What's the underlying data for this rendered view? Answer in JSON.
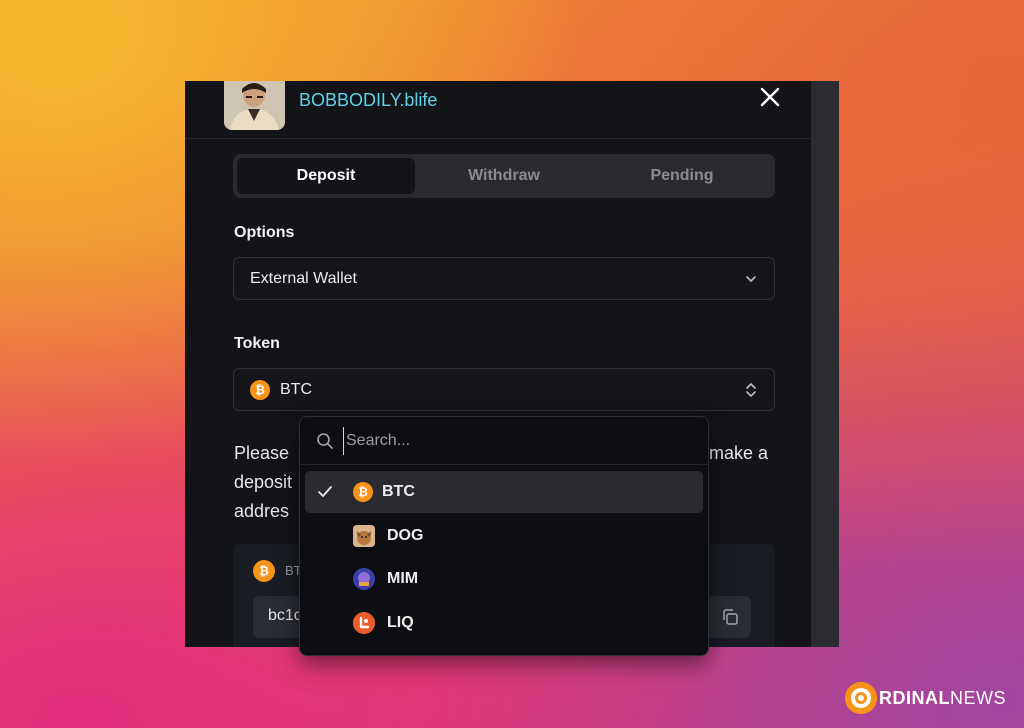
{
  "header": {
    "username": "BOBBODILY.blife"
  },
  "tabs": [
    {
      "label": "Deposit"
    },
    {
      "label": "Withdraw"
    },
    {
      "label": "Pending"
    }
  ],
  "options": {
    "label": "Options",
    "value": "External Wallet"
  },
  "token": {
    "label": "Token",
    "value": "BTC"
  },
  "instructions": {
    "line1_start": "Please",
    "line1_end": "make a",
    "line2_start": "deposit",
    "line3_start": "addres"
  },
  "address_card": {
    "label_fragment": "BT",
    "address_fragment": "bc1c"
  },
  "dropdown": {
    "search_placeholder": "Search...",
    "items": [
      {
        "label": "BTC",
        "selected": true
      },
      {
        "label": "DOG",
        "selected": false
      },
      {
        "label": "MIM",
        "selected": false
      },
      {
        "label": "LIQ",
        "selected": false
      }
    ]
  },
  "watermark": {
    "brand_main": "RDINAL",
    "brand_suffix": "NEWS"
  },
  "colors": {
    "accent_username": "#5fd3e6",
    "btc_orange": "#f7931a",
    "panel_bg": "#131418"
  }
}
